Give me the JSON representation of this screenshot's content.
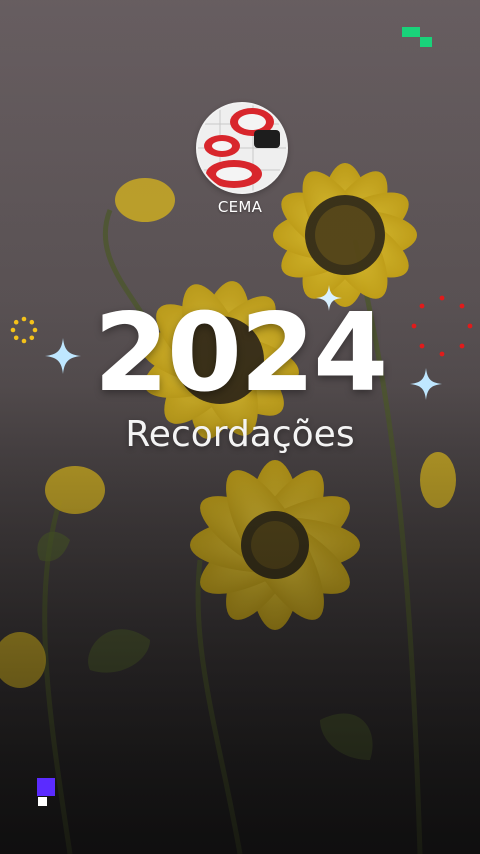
{
  "profile": {
    "name": "CEMA"
  },
  "headline": {
    "year": "2024",
    "subtitle": "Recordações"
  },
  "colors": {
    "accent_green": "#19d27a",
    "accent_purple": "#5b2bff",
    "sparkle": "#bfe7ff",
    "dots_red": "#e01b1b",
    "ring_yellow": "#f4c21a"
  },
  "icons": [
    "sparkle-icon",
    "dotted-ring-icon",
    "pixel-logo-icon"
  ]
}
